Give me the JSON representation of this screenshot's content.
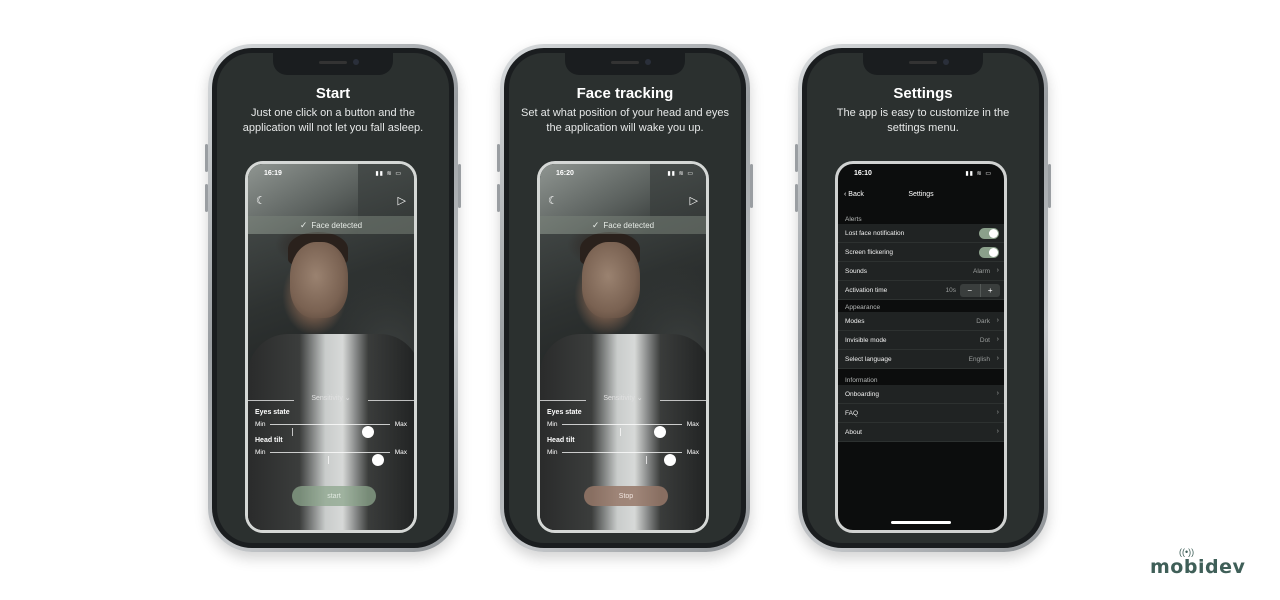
{
  "phones": [
    {
      "title": "Start",
      "subtitle": "Just one click on a button and the application will not let you fall asleep.",
      "time": "16:19",
      "face_banner": "Face detected",
      "sensitivity": "Sensitivity",
      "eyes_label": "Eyes state",
      "head_label": "Head tilt",
      "min_label": "Min",
      "max_label": "Max",
      "button": "start",
      "eyes_level": 0.82,
      "head_level": 0.9
    },
    {
      "title": "Face tracking",
      "subtitle": "Set at what position of your head and eyes the application will wake you up.",
      "time": "16:20",
      "face_banner": "Face detected",
      "sensitivity": "Sensitivity",
      "eyes_label": "Eyes state",
      "head_label": "Head tilt",
      "min_label": "Min",
      "max_label": "Max",
      "button": "Stop",
      "eyes_level": 0.82,
      "head_level": 0.9
    },
    {
      "title": "Settings",
      "subtitle": "The app is easy to customize in the settings menu.",
      "time": "16:10"
    }
  ],
  "settings": {
    "back": "Back",
    "title": "Settings",
    "alerts": {
      "title": "Alerts",
      "lost_face": "Lost face notification",
      "screen_flicker": "Screen flickering",
      "sounds": "Sounds",
      "sounds_value": "Alarm",
      "activation_time": "Activation time",
      "activation_value": "10s",
      "minus": "−",
      "plus": "+"
    },
    "appearance": {
      "title": "Appearance",
      "modes": "Modes",
      "modes_value": "Dark",
      "invisible": "Invisible mode",
      "invisible_value": "Dot",
      "language": "Select language",
      "language_value": "English"
    },
    "information": {
      "title": "Information",
      "onboarding": "Onboarding",
      "faq": "FAQ",
      "about": "About"
    }
  },
  "icons": {
    "moon": "☾",
    "play": "▷",
    "check": "✓",
    "chevron": "›",
    "back_chevron": "‹",
    "dropdown": "⌄"
  },
  "logo": "mobidev",
  "colors": {
    "screen_bg": "#2b302f",
    "toggle_on": "#8ba08b",
    "logo": "#3f5f58"
  }
}
